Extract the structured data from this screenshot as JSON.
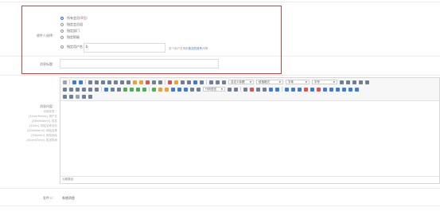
{
  "form": {
    "recipient": {
      "label": "收件人选择：",
      "options": [
        {
          "prefix": "所有会员(",
          "count": "0",
          "suffix": "位)",
          "checked": true
        },
        {
          "text": "指定会员组",
          "checked": false
        },
        {
          "text": "指定部门",
          "checked": false
        },
        {
          "text": "指定职级",
          "checked": false
        },
        {
          "text": "指定用户名",
          "checked": false
        }
      ],
      "username_value": "b",
      "hint_prefix": "多个用户名请用",
      "hint_link": "英文的逗号",
      "hint_suffix": "分隔"
    },
    "title": {
      "label": "消息标题：",
      "value": ""
    },
    "content": {
      "label": "消息内容：",
      "vars_title": "可用标签：",
      "vars": [
        "{$UserName} 用户名",
        "{$RealName} 姓名",
        "{$Site} 网站名称全名",
        "{$SiteName} 网站名称",
        "{$SiteUrl} 网站地址",
        "{$SendTime} 发送时间"
      ],
      "element_path": "元素路径:"
    },
    "sender": {
      "label": "发件人：",
      "value": "系统消息"
    }
  },
  "toolbar": {
    "paragraph_format": "段落格式",
    "font_family": "字体",
    "font_size": "字号",
    "custom_title": "自定义标题",
    "code_language": "代码语言"
  },
  "colors": {
    "highlight": "#e53935",
    "accent": "#3d7cd6",
    "link": "#2f6fd0"
  }
}
